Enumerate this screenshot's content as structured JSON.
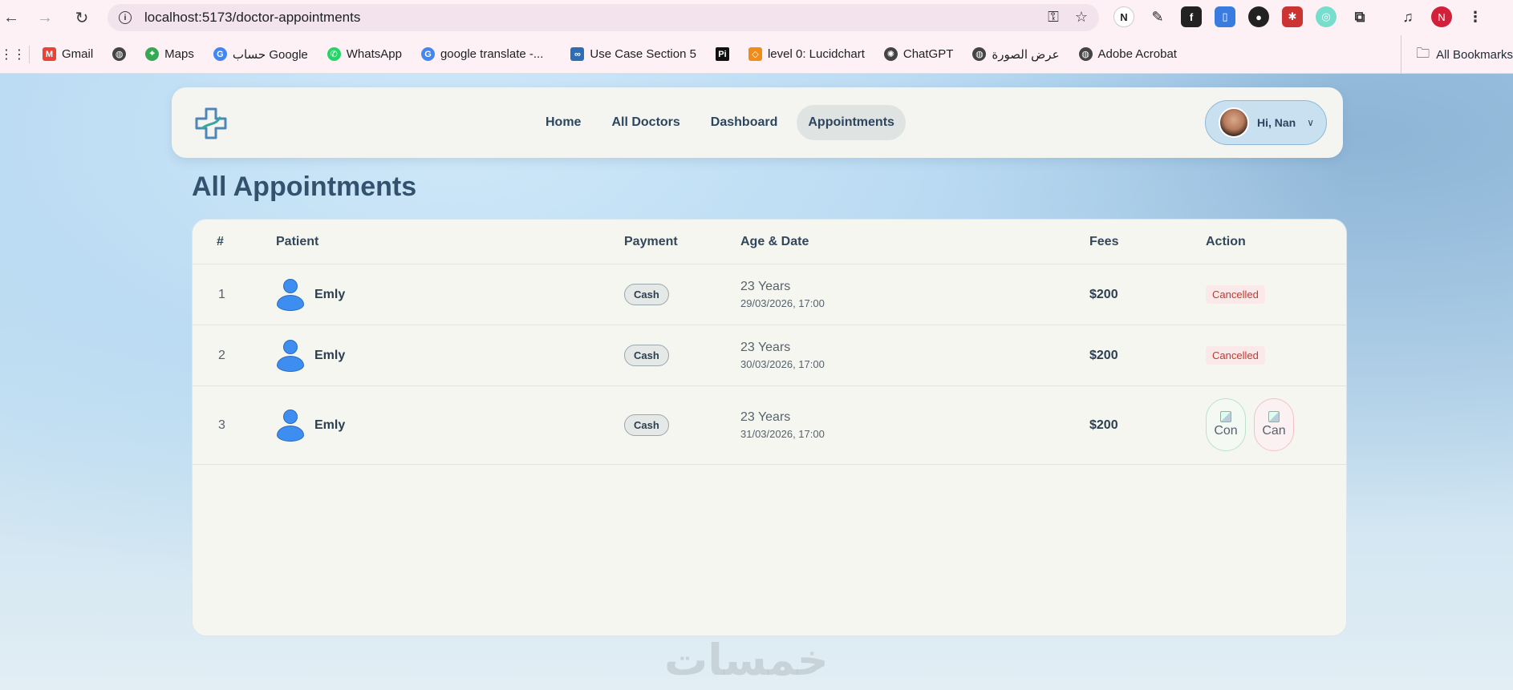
{
  "browser": {
    "url": "localhost:5173/doctor-appointments",
    "profile_initial": "N"
  },
  "bookmarks": {
    "items": [
      {
        "label": "Gmail",
        "icon": "gmail-icon"
      },
      {
        "label": "",
        "icon": "globe-icon"
      },
      {
        "label": "Maps",
        "icon": "maps-icon"
      },
      {
        "label": "حساب Google",
        "icon": "google-icon"
      },
      {
        "label": "WhatsApp",
        "icon": "whatsapp-icon"
      },
      {
        "label": "google translate -...",
        "icon": "google-icon"
      },
      {
        "label": "Use Case Section 5",
        "icon": "bookmark-icon"
      },
      {
        "label": "",
        "icon": "pi-icon"
      },
      {
        "label": "level 0: Lucidchart",
        "icon": "lucidchart-icon"
      },
      {
        "label": "ChatGPT",
        "icon": "chatgpt-icon"
      },
      {
        "label": "عرض الصورة",
        "icon": "globe-icon"
      },
      {
        "label": "Adobe Acrobat",
        "icon": "globe-icon"
      }
    ],
    "all_bookmarks": "All Bookmarks"
  },
  "navbar": {
    "menu": [
      "Home",
      "All Doctors",
      "Dashboard",
      "Appointments"
    ],
    "active": "Appointments",
    "user_greeting": "Hi, Nan"
  },
  "page": {
    "title": "All Appointments"
  },
  "table": {
    "headers": {
      "num": "#",
      "patient": "Patient",
      "payment": "Payment",
      "age_date": "Age & Date",
      "fees": "Fees",
      "action": "Action"
    },
    "rows": [
      {
        "num": "1",
        "patient": "Emly",
        "payment": "Cash",
        "age": "23 Years",
        "date": "29/03/2026, 17:00",
        "fees": "$200",
        "status": "Cancelled"
      },
      {
        "num": "2",
        "patient": "Emly",
        "payment": "Cash",
        "age": "23 Years",
        "date": "30/03/2026, 17:00",
        "fees": "$200",
        "status": "Cancelled"
      },
      {
        "num": "3",
        "patient": "Emly",
        "payment": "Cash",
        "age": "23 Years",
        "date": "31/03/2026, 17:00",
        "fees": "$200",
        "status": "",
        "actions": [
          "Con",
          "Can"
        ]
      }
    ]
  },
  "watermark": "خمسات"
}
